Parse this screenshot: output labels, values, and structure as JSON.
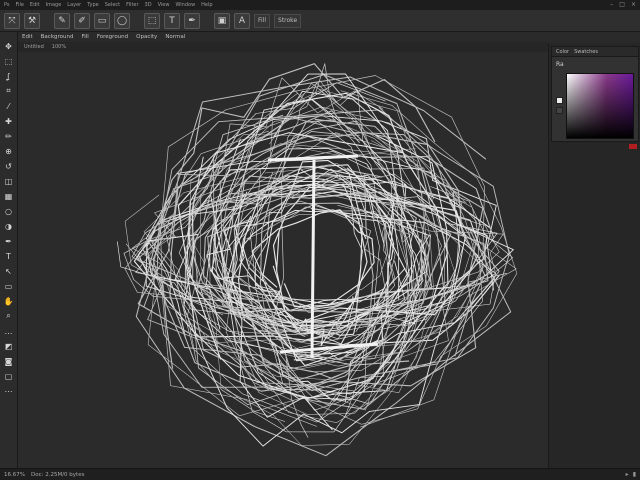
{
  "menu": {
    "items": [
      "Ps",
      "File",
      "Edit",
      "Image",
      "Layer",
      "Type",
      "Select",
      "Filter",
      "3D",
      "View",
      "Window",
      "Help"
    ],
    "window_controls": [
      "–",
      "□",
      "×"
    ]
  },
  "toolbar": {
    "icons": [
      "move-icon",
      "lasso-icon",
      "brush-icon",
      "crop-icon",
      "marquee-icon",
      "ellipse-icon",
      "frame-icon",
      "type-icon",
      "pen-icon",
      "image-icon",
      "text-icon"
    ],
    "glyphs": [
      "⤧",
      "⚒",
      "✎",
      "✐",
      "▭",
      "◯",
      "⬚",
      "T",
      "✒",
      "▣",
      "A"
    ],
    "labels": [
      "Fill",
      "Stroke"
    ]
  },
  "options": {
    "items": [
      "Edit",
      "Background",
      "Fill",
      "Foreground",
      "Opacity",
      "Normal"
    ]
  },
  "document": {
    "tab": "Untitled",
    "zoom": "100%"
  },
  "tools": {
    "icons": [
      "move-tool-icon",
      "marquee-tool-icon",
      "lasso-tool-icon",
      "crop-tool-icon",
      "eyedropper-tool-icon",
      "heal-tool-icon",
      "brush-tool-icon",
      "stamp-tool-icon",
      "history-tool-icon",
      "eraser-tool-icon",
      "gradient-tool-icon",
      "blur-tool-icon",
      "dodge-tool-icon",
      "pen-tool-icon",
      "type-tool-icon",
      "path-tool-icon",
      "shape-tool-icon",
      "hand-tool-icon",
      "zoom-tool-icon",
      "more-tool-icon",
      "fg-bg-icon",
      "quickmask-icon",
      "screen-mode-icon",
      "edit-toolbar-icon"
    ],
    "glyphs": [
      "✥",
      "⬚",
      "ʆ",
      "⌗",
      "⁄",
      "✚",
      "✏",
      "⊕",
      "↺",
      "◫",
      "▦",
      "○",
      "◑",
      "✒",
      "T",
      "↖",
      "▭",
      "✋",
      "⌕",
      "…",
      "◩",
      "◙",
      "▢",
      "⋯"
    ]
  },
  "color_panel": {
    "tabs": [
      "Color",
      "Swatches"
    ],
    "label": "Ra",
    "colors": {
      "spectrum_light": "#ffffff",
      "spectrum_mid": "#8a3a8a",
      "spectrum_dark": "#6a1a9a",
      "accent_red": "#b02020"
    }
  },
  "status": {
    "zoom": "16.67%",
    "doc_info": "Doc: 2.25M/0 bytes",
    "right": [
      "▸",
      "▮"
    ]
  }
}
